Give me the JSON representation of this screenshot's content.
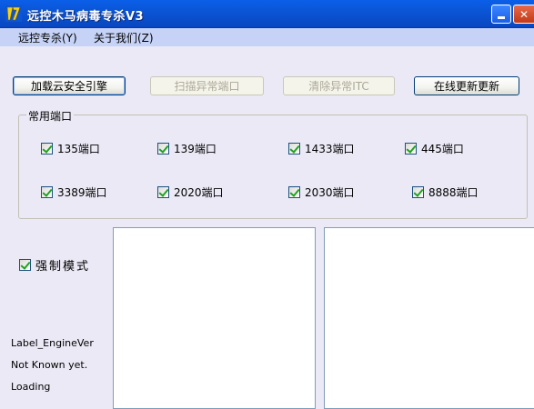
{
  "window": {
    "title": "远控木马病毒专杀V3",
    "minimize_symbol": "_",
    "close_symbol": "✕"
  },
  "menu": {
    "items": [
      {
        "label": "远控专杀(Y)"
      },
      {
        "label": "关于我们(Z)"
      }
    ]
  },
  "toolbar": {
    "load_engine_label": "加载云安全引擎",
    "scan_ports_label": "扫描异常端口",
    "clear_itc_label": "清除异常ITC",
    "online_update_label": "在线更新更新"
  },
  "ports_group": {
    "title": "常用端口",
    "ports": [
      {
        "label": "135端口",
        "checked": true
      },
      {
        "label": "139端口",
        "checked": true
      },
      {
        "label": "1433端口",
        "checked": true
      },
      {
        "label": "445端口",
        "checked": true
      },
      {
        "label": "3389端口",
        "checked": true
      },
      {
        "label": "2020端口",
        "checked": true
      },
      {
        "label": "2030端口",
        "checked": true
      },
      {
        "label": "8888端口",
        "checked": true
      }
    ]
  },
  "force_mode": {
    "label": "强制模式",
    "checked": true
  },
  "status": {
    "engine_label": "Label_EngineVer",
    "known_text": "Not Known yet.",
    "loading_text": "Loading"
  },
  "colors": {
    "titlebar": "#0b55d6",
    "menubar": "#c6d3f7",
    "client_bg": "#ebe9f5",
    "check_green": "#21a121"
  }
}
